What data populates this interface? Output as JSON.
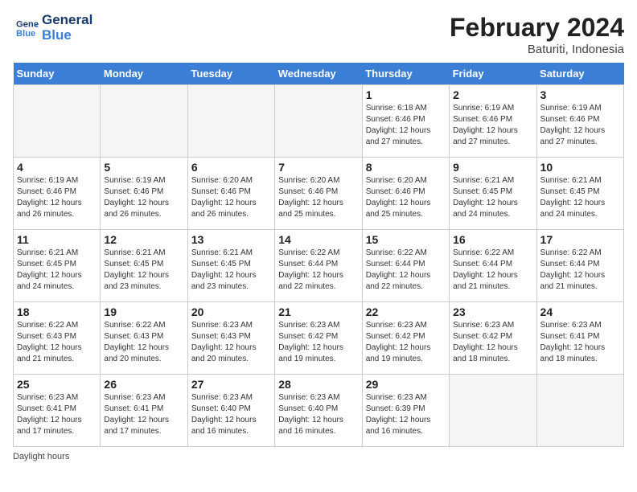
{
  "header": {
    "logo_general": "General",
    "logo_blue": "Blue",
    "title": "February 2024",
    "location": "Baturiti, Indonesia"
  },
  "weekdays": [
    "Sunday",
    "Monday",
    "Tuesday",
    "Wednesday",
    "Thursday",
    "Friday",
    "Saturday"
  ],
  "weeks": [
    [
      {
        "day": "",
        "info": ""
      },
      {
        "day": "",
        "info": ""
      },
      {
        "day": "",
        "info": ""
      },
      {
        "day": "",
        "info": ""
      },
      {
        "day": "1",
        "info": "Sunrise: 6:18 AM\nSunset: 6:46 PM\nDaylight: 12 hours\nand 27 minutes."
      },
      {
        "day": "2",
        "info": "Sunrise: 6:19 AM\nSunset: 6:46 PM\nDaylight: 12 hours\nand 27 minutes."
      },
      {
        "day": "3",
        "info": "Sunrise: 6:19 AM\nSunset: 6:46 PM\nDaylight: 12 hours\nand 27 minutes."
      }
    ],
    [
      {
        "day": "4",
        "info": "Sunrise: 6:19 AM\nSunset: 6:46 PM\nDaylight: 12 hours\nand 26 minutes."
      },
      {
        "day": "5",
        "info": "Sunrise: 6:19 AM\nSunset: 6:46 PM\nDaylight: 12 hours\nand 26 minutes."
      },
      {
        "day": "6",
        "info": "Sunrise: 6:20 AM\nSunset: 6:46 PM\nDaylight: 12 hours\nand 26 minutes."
      },
      {
        "day": "7",
        "info": "Sunrise: 6:20 AM\nSunset: 6:46 PM\nDaylight: 12 hours\nand 25 minutes."
      },
      {
        "day": "8",
        "info": "Sunrise: 6:20 AM\nSunset: 6:46 PM\nDaylight: 12 hours\nand 25 minutes."
      },
      {
        "day": "9",
        "info": "Sunrise: 6:21 AM\nSunset: 6:45 PM\nDaylight: 12 hours\nand 24 minutes."
      },
      {
        "day": "10",
        "info": "Sunrise: 6:21 AM\nSunset: 6:45 PM\nDaylight: 12 hours\nand 24 minutes."
      }
    ],
    [
      {
        "day": "11",
        "info": "Sunrise: 6:21 AM\nSunset: 6:45 PM\nDaylight: 12 hours\nand 24 minutes."
      },
      {
        "day": "12",
        "info": "Sunrise: 6:21 AM\nSunset: 6:45 PM\nDaylight: 12 hours\nand 23 minutes."
      },
      {
        "day": "13",
        "info": "Sunrise: 6:21 AM\nSunset: 6:45 PM\nDaylight: 12 hours\nand 23 minutes."
      },
      {
        "day": "14",
        "info": "Sunrise: 6:22 AM\nSunset: 6:44 PM\nDaylight: 12 hours\nand 22 minutes."
      },
      {
        "day": "15",
        "info": "Sunrise: 6:22 AM\nSunset: 6:44 PM\nDaylight: 12 hours\nand 22 minutes."
      },
      {
        "day": "16",
        "info": "Sunrise: 6:22 AM\nSunset: 6:44 PM\nDaylight: 12 hours\nand 21 minutes."
      },
      {
        "day": "17",
        "info": "Sunrise: 6:22 AM\nSunset: 6:44 PM\nDaylight: 12 hours\nand 21 minutes."
      }
    ],
    [
      {
        "day": "18",
        "info": "Sunrise: 6:22 AM\nSunset: 6:43 PM\nDaylight: 12 hours\nand 21 minutes."
      },
      {
        "day": "19",
        "info": "Sunrise: 6:22 AM\nSunset: 6:43 PM\nDaylight: 12 hours\nand 20 minutes."
      },
      {
        "day": "20",
        "info": "Sunrise: 6:23 AM\nSunset: 6:43 PM\nDaylight: 12 hours\nand 20 minutes."
      },
      {
        "day": "21",
        "info": "Sunrise: 6:23 AM\nSunset: 6:42 PM\nDaylight: 12 hours\nand 19 minutes."
      },
      {
        "day": "22",
        "info": "Sunrise: 6:23 AM\nSunset: 6:42 PM\nDaylight: 12 hours\nand 19 minutes."
      },
      {
        "day": "23",
        "info": "Sunrise: 6:23 AM\nSunset: 6:42 PM\nDaylight: 12 hours\nand 18 minutes."
      },
      {
        "day": "24",
        "info": "Sunrise: 6:23 AM\nSunset: 6:41 PM\nDaylight: 12 hours\nand 18 minutes."
      }
    ],
    [
      {
        "day": "25",
        "info": "Sunrise: 6:23 AM\nSunset: 6:41 PM\nDaylight: 12 hours\nand 17 minutes."
      },
      {
        "day": "26",
        "info": "Sunrise: 6:23 AM\nSunset: 6:41 PM\nDaylight: 12 hours\nand 17 minutes."
      },
      {
        "day": "27",
        "info": "Sunrise: 6:23 AM\nSunset: 6:40 PM\nDaylight: 12 hours\nand 16 minutes."
      },
      {
        "day": "28",
        "info": "Sunrise: 6:23 AM\nSunset: 6:40 PM\nDaylight: 12 hours\nand 16 minutes."
      },
      {
        "day": "29",
        "info": "Sunrise: 6:23 AM\nSunset: 6:39 PM\nDaylight: 12 hours\nand 16 minutes."
      },
      {
        "day": "",
        "info": ""
      },
      {
        "day": "",
        "info": ""
      }
    ]
  ],
  "footer": {
    "daylight_label": "Daylight hours"
  }
}
